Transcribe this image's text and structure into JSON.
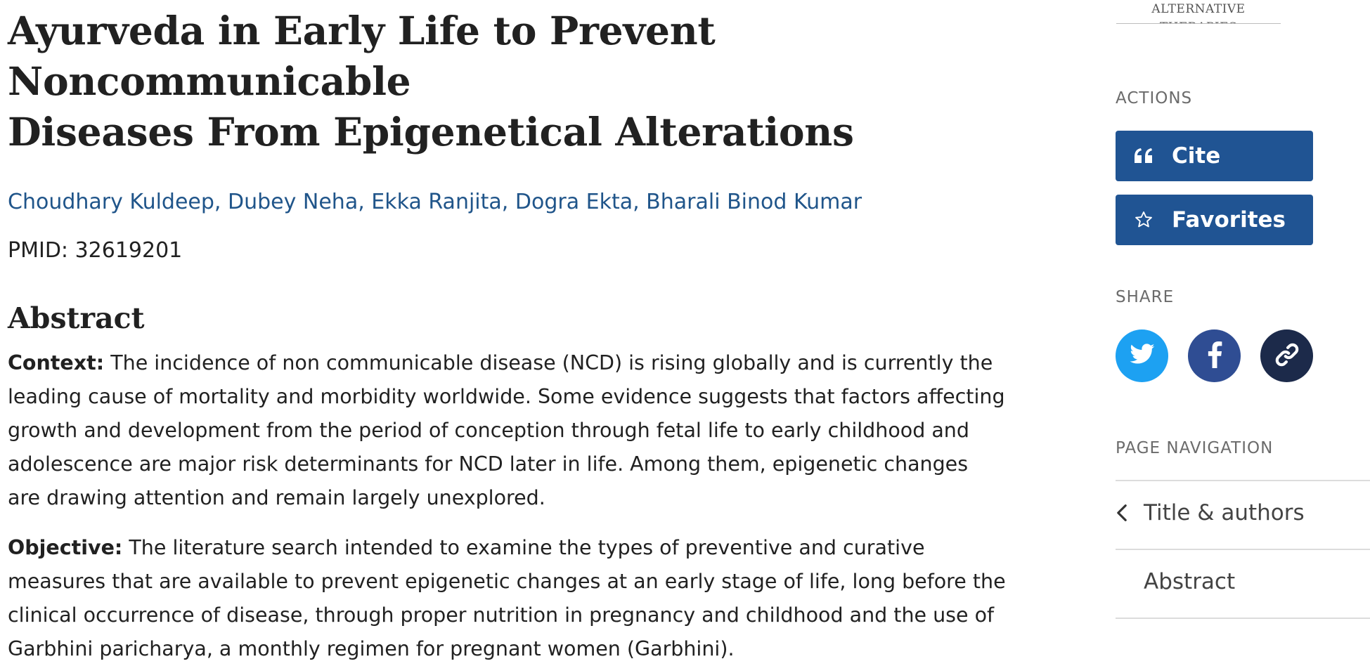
{
  "article": {
    "title_line1": "Ayurveda in Early Life to Prevent Noncommunicable",
    "title_line2": "Diseases From Epigenetical Alterations",
    "authors": [
      "Choudhary Kuldeep",
      "Dubey Neha",
      "Ekka Ranjita",
      "Dogra Ekta",
      "Bharali Binod Kumar"
    ],
    "author_separator": ", ",
    "pmid_label": "PMID:",
    "pmid_value": "32619201"
  },
  "abstract": {
    "heading": "Abstract",
    "sections": [
      {
        "label": "Context:",
        "text": "The incidence of non communicable disease (NCD) is rising globally and is currently the leading cause of mortality and morbidity worldwide. Some evidence suggests that factors affecting growth and development from the period of conception through fetal life to early childhood and adolescence are major risk determinants for NCD later in life. Among them, epigenetic changes are drawing attention and remain largely unexplored."
      },
      {
        "label": "Objective:",
        "text": "The literature search intended to examine the types of preventive and curative measures that are available to prevent epigenetic changes at an early stage of life, long before the clinical occurrence of disease, through proper nutrition in pregnancy and childhood and the use of Garbhini paricharya, a monthly regimen for pregnant women (Garbhini)."
      }
    ]
  },
  "sidebar": {
    "journal_logo_text": "ALTERNATIVE THERAPIES",
    "actions_heading": "ACTIONS",
    "cite_label": "Cite",
    "cite_icon": "quote-icon",
    "favorites_label": "Favorites",
    "favorites_icon": "star-outline-icon",
    "share_heading": "SHARE",
    "share_buttons": [
      {
        "name": "twitter",
        "icon": "twitter-icon",
        "color": "#1da1f2"
      },
      {
        "name": "facebook",
        "icon": "facebook-icon",
        "color": "#2f4d93"
      },
      {
        "name": "permalink",
        "icon": "link-icon",
        "color": "#1c2a4a"
      }
    ],
    "page_nav_heading": "PAGE NAVIGATION",
    "page_nav_items": [
      {
        "label": "Title & authors",
        "icon": "chevron-left-icon"
      },
      {
        "label": "Abstract"
      }
    ]
  },
  "colors": {
    "link": "#20558a",
    "button": "#205493",
    "text": "#212121",
    "muted": "#6b6b6b"
  }
}
